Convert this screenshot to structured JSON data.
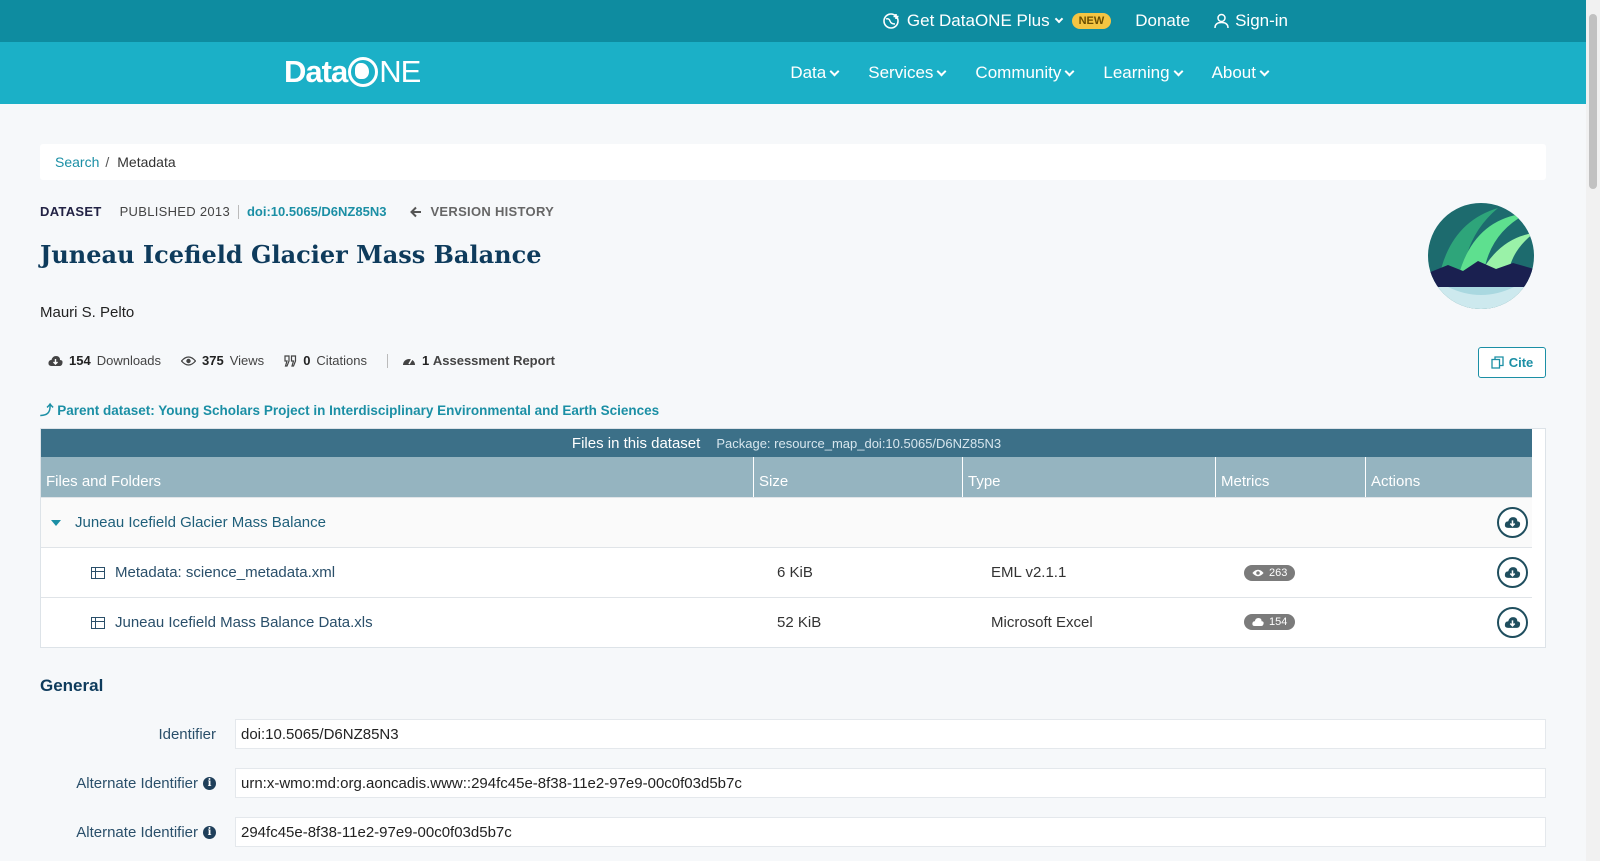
{
  "topbar": {
    "get_plus": "Get DataONE Plus",
    "new_badge": "NEW",
    "donate": "Donate",
    "signin": "Sign-in"
  },
  "brand": {
    "logo_left": "Data",
    "logo_right": "NE"
  },
  "nav": {
    "items": [
      {
        "label": "Data"
      },
      {
        "label": "Services"
      },
      {
        "label": "Community"
      },
      {
        "label": "Learning"
      },
      {
        "label": "About"
      }
    ]
  },
  "breadcrumb": {
    "search": "Search",
    "sep": "/",
    "current": "Metadata"
  },
  "dataset": {
    "type": "DATASET",
    "published": "PUBLISHED 2013",
    "doi": "doi:10.5065/D6NZ85N3",
    "version_history": "VERSION HISTORY",
    "title": "Juneau Icefield Glacier Mass Balance",
    "author": "Mauri S. Pelto"
  },
  "stats": {
    "downloads_count": "154",
    "downloads_label": "Downloads",
    "views_count": "375",
    "views_label": "Views",
    "citations_count": "0",
    "citations_label": "Citations",
    "assessment_count": "1",
    "assessment_label": "Assessment Report"
  },
  "cite_label": "Cite",
  "parent": {
    "text": "Parent dataset: Young Scholars Project in Interdisciplinary Environmental and Earth Sciences"
  },
  "files": {
    "heading": "Files in this dataset",
    "package": "Package: resource_map_doi:10.5065/D6NZ85N3",
    "columns": [
      "Files and Folders",
      "Size",
      "Type",
      "Metrics",
      "Actions"
    ],
    "folder": "Juneau Icefield Glacier Mass Balance",
    "rows": [
      {
        "name": "Metadata: science_metadata.xml",
        "size": "6 KiB",
        "type": "EML v2.1.1",
        "metric": "263",
        "metric_icon": "eye-icon"
      },
      {
        "name": "Juneau Icefield Mass Balance Data.xls",
        "size": "52 KiB",
        "type": "Microsoft Excel",
        "metric": "154",
        "metric_icon": "cloud-download-icon"
      }
    ]
  },
  "general": {
    "heading": "General",
    "fields": [
      {
        "label": "Identifier",
        "value": "doi:10.5065/D6NZ85N3"
      },
      {
        "label": "Alternate Identifier",
        "value": "urn:x-wmo:md:org.aoncadis.www::294fc45e-8f38-11e2-97e9-00c0f03d5b7c"
      },
      {
        "label": "Alternate Identifier",
        "value": "294fc45e-8f38-11e2-97e9-00c0f03d5b7c"
      }
    ]
  },
  "colors": {
    "topbar": "#0e8ca0",
    "navbar": "#1bb0c7",
    "accent": "#1b8fa5",
    "table_header": "#3c7088",
    "table_columns": "#95b4c0"
  }
}
